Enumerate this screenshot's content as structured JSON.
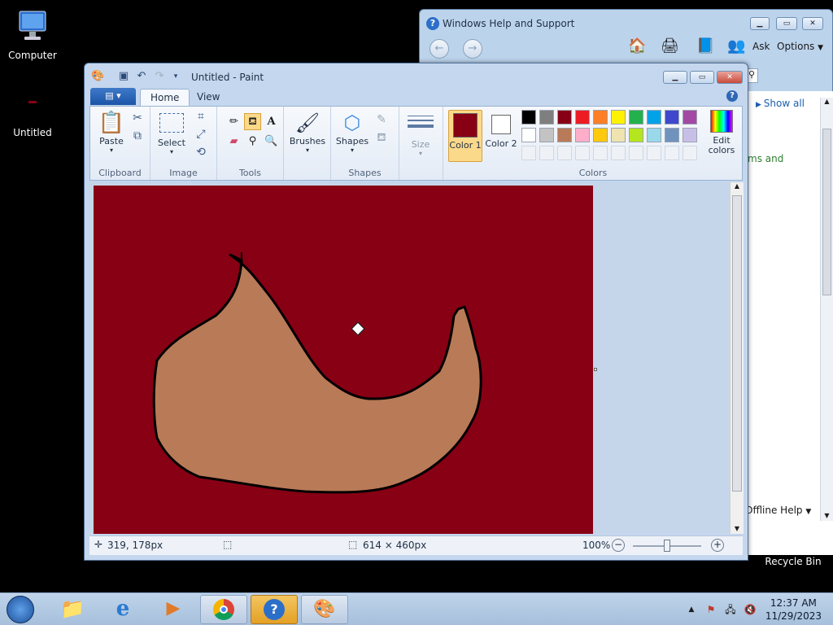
{
  "desktop": {
    "icons": [
      {
        "label": "Computer",
        "icon": "computer-icon"
      },
      {
        "label": "Untitled",
        "icon": "image-file-icon"
      },
      {
        "label": "Recycle Bin",
        "icon": "recycle-bin-icon"
      }
    ]
  },
  "help_window": {
    "title": "Windows Help and Support",
    "toolbar": {
      "ask": "Ask",
      "options": "Options"
    },
    "show_all": "Show all",
    "body_fragment": "ms and",
    "footer": "Offline Help"
  },
  "paint": {
    "title": "Untitled - Paint",
    "tabs": {
      "home": "Home",
      "view": "View"
    },
    "groups": {
      "clipboard": {
        "label": "Clipboard",
        "paste": "Paste"
      },
      "image": {
        "label": "Image",
        "select": "Select"
      },
      "tools": {
        "label": "Tools"
      },
      "shapes": {
        "label": "Shapes",
        "brushes": "Brushes",
        "shapes_btn": "Shapes"
      },
      "size": {
        "label": "Size"
      },
      "colors": {
        "label": "Colors",
        "color1": "Color 1",
        "color2": "Color 2",
        "edit": "Edit colors",
        "color1_value": "#870014",
        "color2_value": "#ffffff",
        "palette_row1": [
          "#000000",
          "#7f7f7f",
          "#880015",
          "#ed1c24",
          "#ff7f27",
          "#fff200",
          "#22b14c",
          "#00a2e8",
          "#3f48cc",
          "#a349a4"
        ],
        "palette_row2": [
          "#ffffff",
          "#c3c3c3",
          "#b97a57",
          "#ffaec9",
          "#ffc90e",
          "#efe4b0",
          "#b5e61d",
          "#99d9ea",
          "#7092be",
          "#c8bfe7"
        ]
      }
    },
    "canvas": {
      "background": "#870014",
      "shape_fill": "#b97a57"
    },
    "status": {
      "cursor_pos": "319, 178px",
      "size": "614 × 460px",
      "zoom": "100%"
    }
  },
  "taskbar": {
    "time": "12:37 AM",
    "date": "11/29/2023"
  }
}
